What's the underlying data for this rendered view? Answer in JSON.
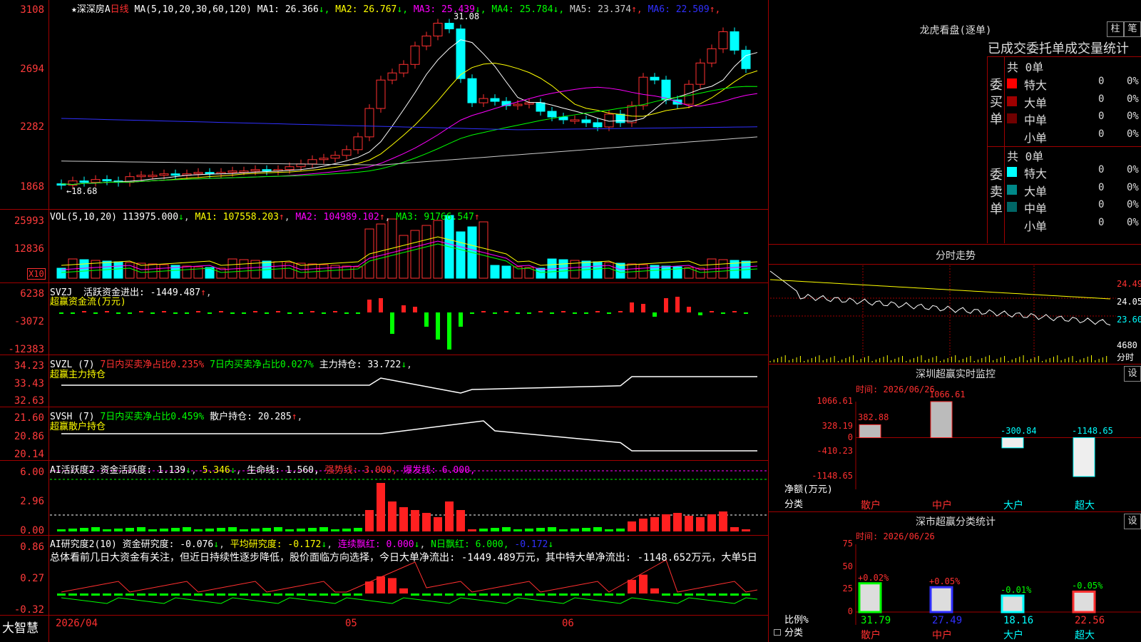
{
  "main_chart": {
    "stock_name": "深深房A",
    "period": "日线",
    "ma_label": "MA(5,10,20,30,60,120)",
    "ma_values": [
      {
        "name": "MA1:",
        "value": "26.366",
        "arrow": "↓",
        "color": "#ffffff"
      },
      {
        "name": "MA2:",
        "value": "26.767",
        "arrow": "↓",
        "color": "#ffff00"
      },
      {
        "name": "MA3:",
        "value": "25.439",
        "arrow": "↓",
        "color": "#ff00ff"
      },
      {
        "name": "MA4:",
        "value": "25.784",
        "arrow": "↓",
        "color": "#00ff00"
      },
      {
        "name": "MA5:",
        "value": "23.374",
        "arrow": "↑",
        "color": "#cccccc"
      },
      {
        "name": "MA6:",
        "value": "22.509",
        "arrow": "↑",
        "color": "#3030ff"
      }
    ],
    "y_ticks": [
      "3108",
      "2694",
      "2282",
      "1868"
    ],
    "high_label": "31.08",
    "low_label": "←18.68"
  },
  "vol_panel": {
    "label": "VOL(5,10,20)",
    "value": "113975.000",
    "ma1": "MA1: 107558.203",
    "ma2": "MA2: 104989.102",
    "ma3": "MA3: 91766.547",
    "y_ticks": [
      "25993",
      "12836"
    ],
    "unit": "X10"
  },
  "svzj_panel": {
    "label": "SVZJ",
    "desc": "活跃资金进出: -1449.487",
    "subtitle": "超赢资金流(万元)",
    "y_ticks": [
      "6238",
      "-3072",
      "-12383"
    ]
  },
  "svzl_panel": {
    "label": "SVZL (7)",
    "a": "7日内买卖净占比0.235%",
    "b": "7日内买卖净占比0.027%",
    "c": "主力持仓: 33.722",
    "subtitle": "超赢主力持仓",
    "y_ticks": [
      "34.23",
      "33.43",
      "32.63"
    ]
  },
  "svsh_panel": {
    "label": "SVSH (7)",
    "a": "7日内买卖净占比0.459%",
    "c": "散户持仓: 20.285",
    "subtitle": "超赢散户持仓",
    "y_ticks": [
      "21.60",
      "20.86",
      "20.14"
    ]
  },
  "ai_active": {
    "label": "AI活跃度2",
    "a": "资金活跃度: 1.139",
    "b": "5.346",
    "c": "生命线: 1.560,",
    "d": "强势线: 3.000,",
    "e": "爆发线: 6.000,",
    "y_ticks": [
      "6.00",
      "2.96",
      "0.00"
    ]
  },
  "ai_research": {
    "label": "AI研究度2(10)",
    "a": "资金研究度: -0.076",
    "b": "平均研究度: -0.172",
    "c": "连续飘红: 0.000",
    "d": "N日飘红: 6.000,",
    "e": "-0.172",
    "summary": "总体看前几日大资金有关注，但近日持续性逐步降低，股价面临方向选择，今日大单净流出: -1449.489万元，其中特大单净流出: -1148.652万元，大单5日",
    "y_ticks": [
      "0.86",
      "0.27",
      "-0.32"
    ]
  },
  "x_axis": {
    "d1": "2026/04",
    "d2": "05",
    "d3": "06"
  },
  "footer": {
    "brand": "大智慧"
  },
  "longhu": {
    "title": "龙虎看盘(逐单)",
    "btn1": "柱",
    "btn2": "笔",
    "header": "已成交委托单成交量统计",
    "buy_label": "委买单",
    "sell_label": "委卖单",
    "buy_total": "共 0单",
    "sell_total": "共 0单",
    "buy_rows": [
      {
        "name": "特大",
        "num": "0",
        "pct": "0%",
        "color": "#ff0000"
      },
      {
        "name": "大单",
        "num": "0",
        "pct": "0%",
        "color": "#a00000"
      },
      {
        "name": "中单",
        "num": "0",
        "pct": "0%",
        "color": "#700000"
      },
      {
        "name": "小单",
        "num": "0",
        "pct": "0%",
        "color": "#000000"
      }
    ],
    "sell_rows": [
      {
        "name": "特大",
        "num": "0",
        "pct": "0%",
        "color": "#00ffff"
      },
      {
        "name": "大单",
        "num": "0",
        "pct": "0%",
        "color": "#008888"
      },
      {
        "name": "中单",
        "num": "0",
        "pct": "0%",
        "color": "#006666"
      },
      {
        "name": "小单",
        "num": "0",
        "pct": "0%",
        "color": "#000000"
      }
    ]
  },
  "intraday": {
    "title": "分时走势",
    "prices": [
      "24.49",
      "24.05",
      "23.60"
    ],
    "vol": "4680",
    "vol_label": "分时"
  },
  "monitor": {
    "title": "深圳超赢实时监控",
    "settings": "设",
    "time": "时间: 2026/06/26",
    "y_ticks": [
      "1066.61",
      "328.19",
      "0",
      "-410.23",
      "-1148.65"
    ],
    "y_label": "净额(万元)",
    "x_label": "分类",
    "bars": [
      {
        "cat": "散户",
        "value": 382.88,
        "label": "382.88"
      },
      {
        "cat": "中户",
        "value": 1066.61,
        "label": "1066.61"
      },
      {
        "cat": "大户",
        "value": -300.84,
        "label": "-300.84"
      },
      {
        "cat": "超大",
        "value": -1148.65,
        "label": "-1148.65"
      }
    ]
  },
  "classify": {
    "title": "深市超赢分类统计",
    "settings": "设",
    "time": "时间: 2026/06/26",
    "y_ticks": [
      "75",
      "50",
      "25",
      "0"
    ],
    "y_label": "比例%",
    "x_label": "分类",
    "bars": [
      {
        "cat": "散户",
        "value": 31.79,
        "label": "31.79",
        "change": "+0.02%"
      },
      {
        "cat": "中户",
        "value": 27.49,
        "label": "27.49",
        "change": "+0.05%"
      },
      {
        "cat": "大户",
        "value": 18.16,
        "label": "18.16",
        "change": "-0.01%"
      },
      {
        "cat": "超大",
        "value": 22.56,
        "label": "22.56",
        "change": "-0.05%"
      }
    ]
  }
}
